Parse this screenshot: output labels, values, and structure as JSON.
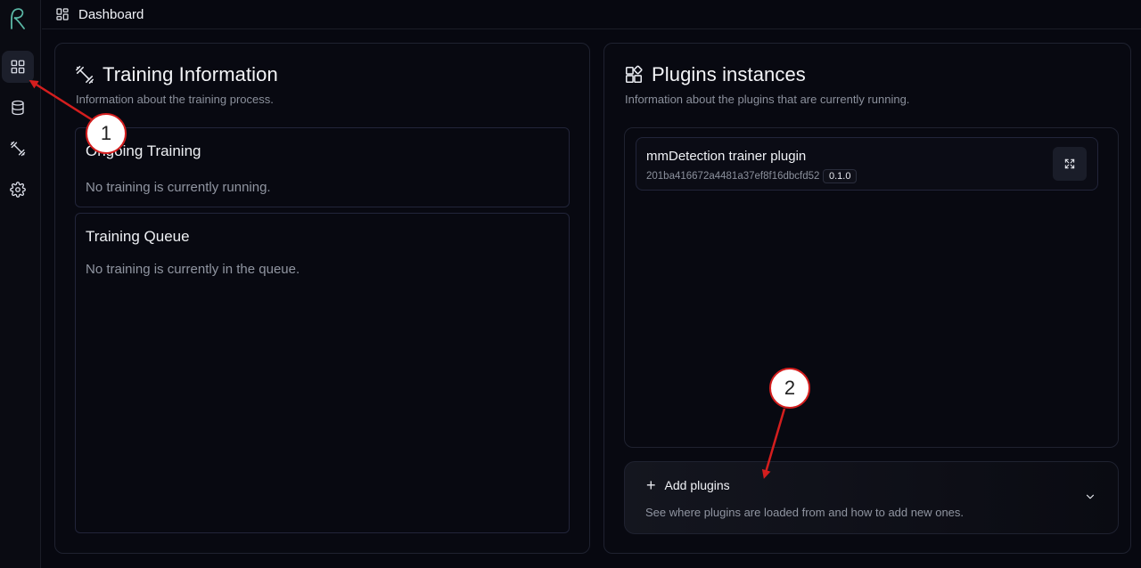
{
  "topbar": {
    "title": "Dashboard"
  },
  "sidebar": {
    "items": [
      {
        "icon": "dashboard-icon",
        "active": true
      },
      {
        "icon": "database-icon",
        "active": false
      },
      {
        "icon": "dumbbell-icon",
        "active": false
      },
      {
        "icon": "gear-icon",
        "active": false
      }
    ]
  },
  "training": {
    "title": "Training Information",
    "subtitle": "Information about the training process.",
    "ongoing": {
      "title": "Ongoing Training",
      "empty": "No training is currently running."
    },
    "queue": {
      "title": "Training Queue",
      "empty": "No training is currently in the queue."
    }
  },
  "plugins": {
    "title": "Plugins instances",
    "subtitle": "Information about the plugins that are currently running.",
    "items": [
      {
        "name": "mmDetection trainer plugin",
        "id": "201ba416672a4481a37ef8f16dbcfd52",
        "version": "0.1.0"
      }
    ],
    "add": {
      "label": "Add plugins",
      "description": "See where plugins are loaded from and how to add new ones."
    }
  },
  "annotations": {
    "first": "1",
    "second": "2"
  },
  "colors": {
    "background": "#070810",
    "annotation_red": "#d41e1e",
    "accent_logo": "#5bb8a6"
  }
}
